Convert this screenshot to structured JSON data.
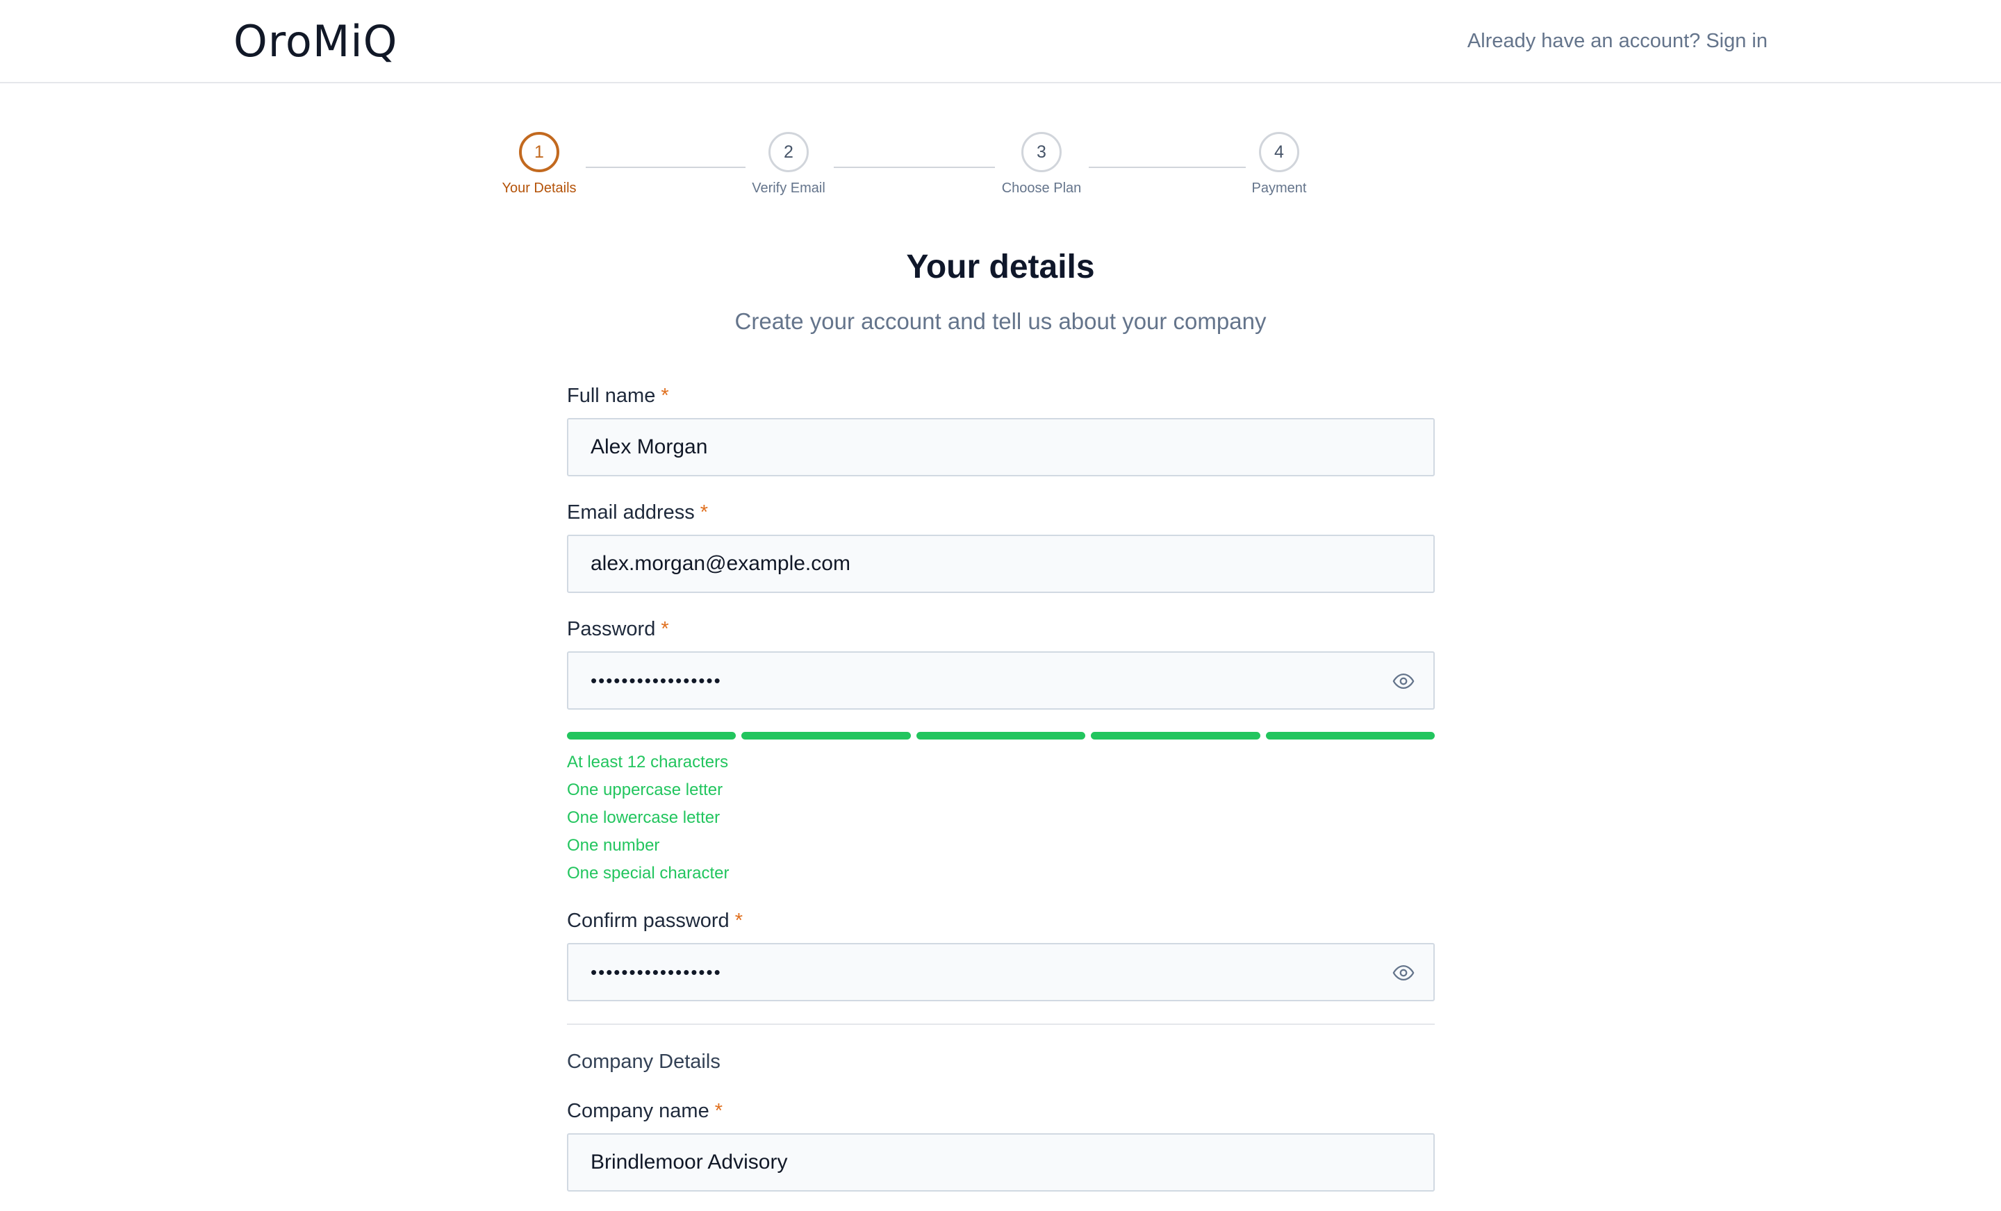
{
  "header": {
    "logo": "OroMiQ",
    "signin_link": "Already have an account? Sign in"
  },
  "stepper": {
    "steps": [
      {
        "number": "1",
        "label": "Your Details",
        "state": "active"
      },
      {
        "number": "2",
        "label": "Verify Email",
        "state": "upcoming"
      },
      {
        "number": "3",
        "label": "Choose Plan",
        "state": "upcoming"
      },
      {
        "number": "4",
        "label": "Payment",
        "state": "upcoming"
      }
    ]
  },
  "page": {
    "title": "Your details",
    "subtitle": "Create your account and tell us about your company"
  },
  "form": {
    "full_name": {
      "label": "Full name",
      "required_mark": "*",
      "value": "Alex Morgan"
    },
    "email": {
      "label": "Email address",
      "required_mark": "*",
      "value": "alex.morgan@example.com"
    },
    "password": {
      "label": "Password",
      "required_mark": "*",
      "value": "•••••••••••••••••",
      "visibility_icon": "eye-icon"
    },
    "password_strength": {
      "segments_filled": 5,
      "segments_total": 5,
      "color": "#22c55e"
    },
    "password_requirements": [
      "At least 12 characters",
      "One uppercase letter",
      "One lowercase letter",
      "One number",
      "One special character"
    ],
    "confirm_password": {
      "label": "Confirm password",
      "required_mark": "*",
      "value": "•••••••••••••••••",
      "visibility_icon": "eye-icon"
    },
    "company_section_title": "Company Details",
    "company_name": {
      "label": "Company name",
      "required_mark": "*",
      "value": "Brindlemoor Advisory"
    }
  },
  "colors": {
    "accent": "#c2691f",
    "required": "#e0701f",
    "success": "#22c55e"
  }
}
